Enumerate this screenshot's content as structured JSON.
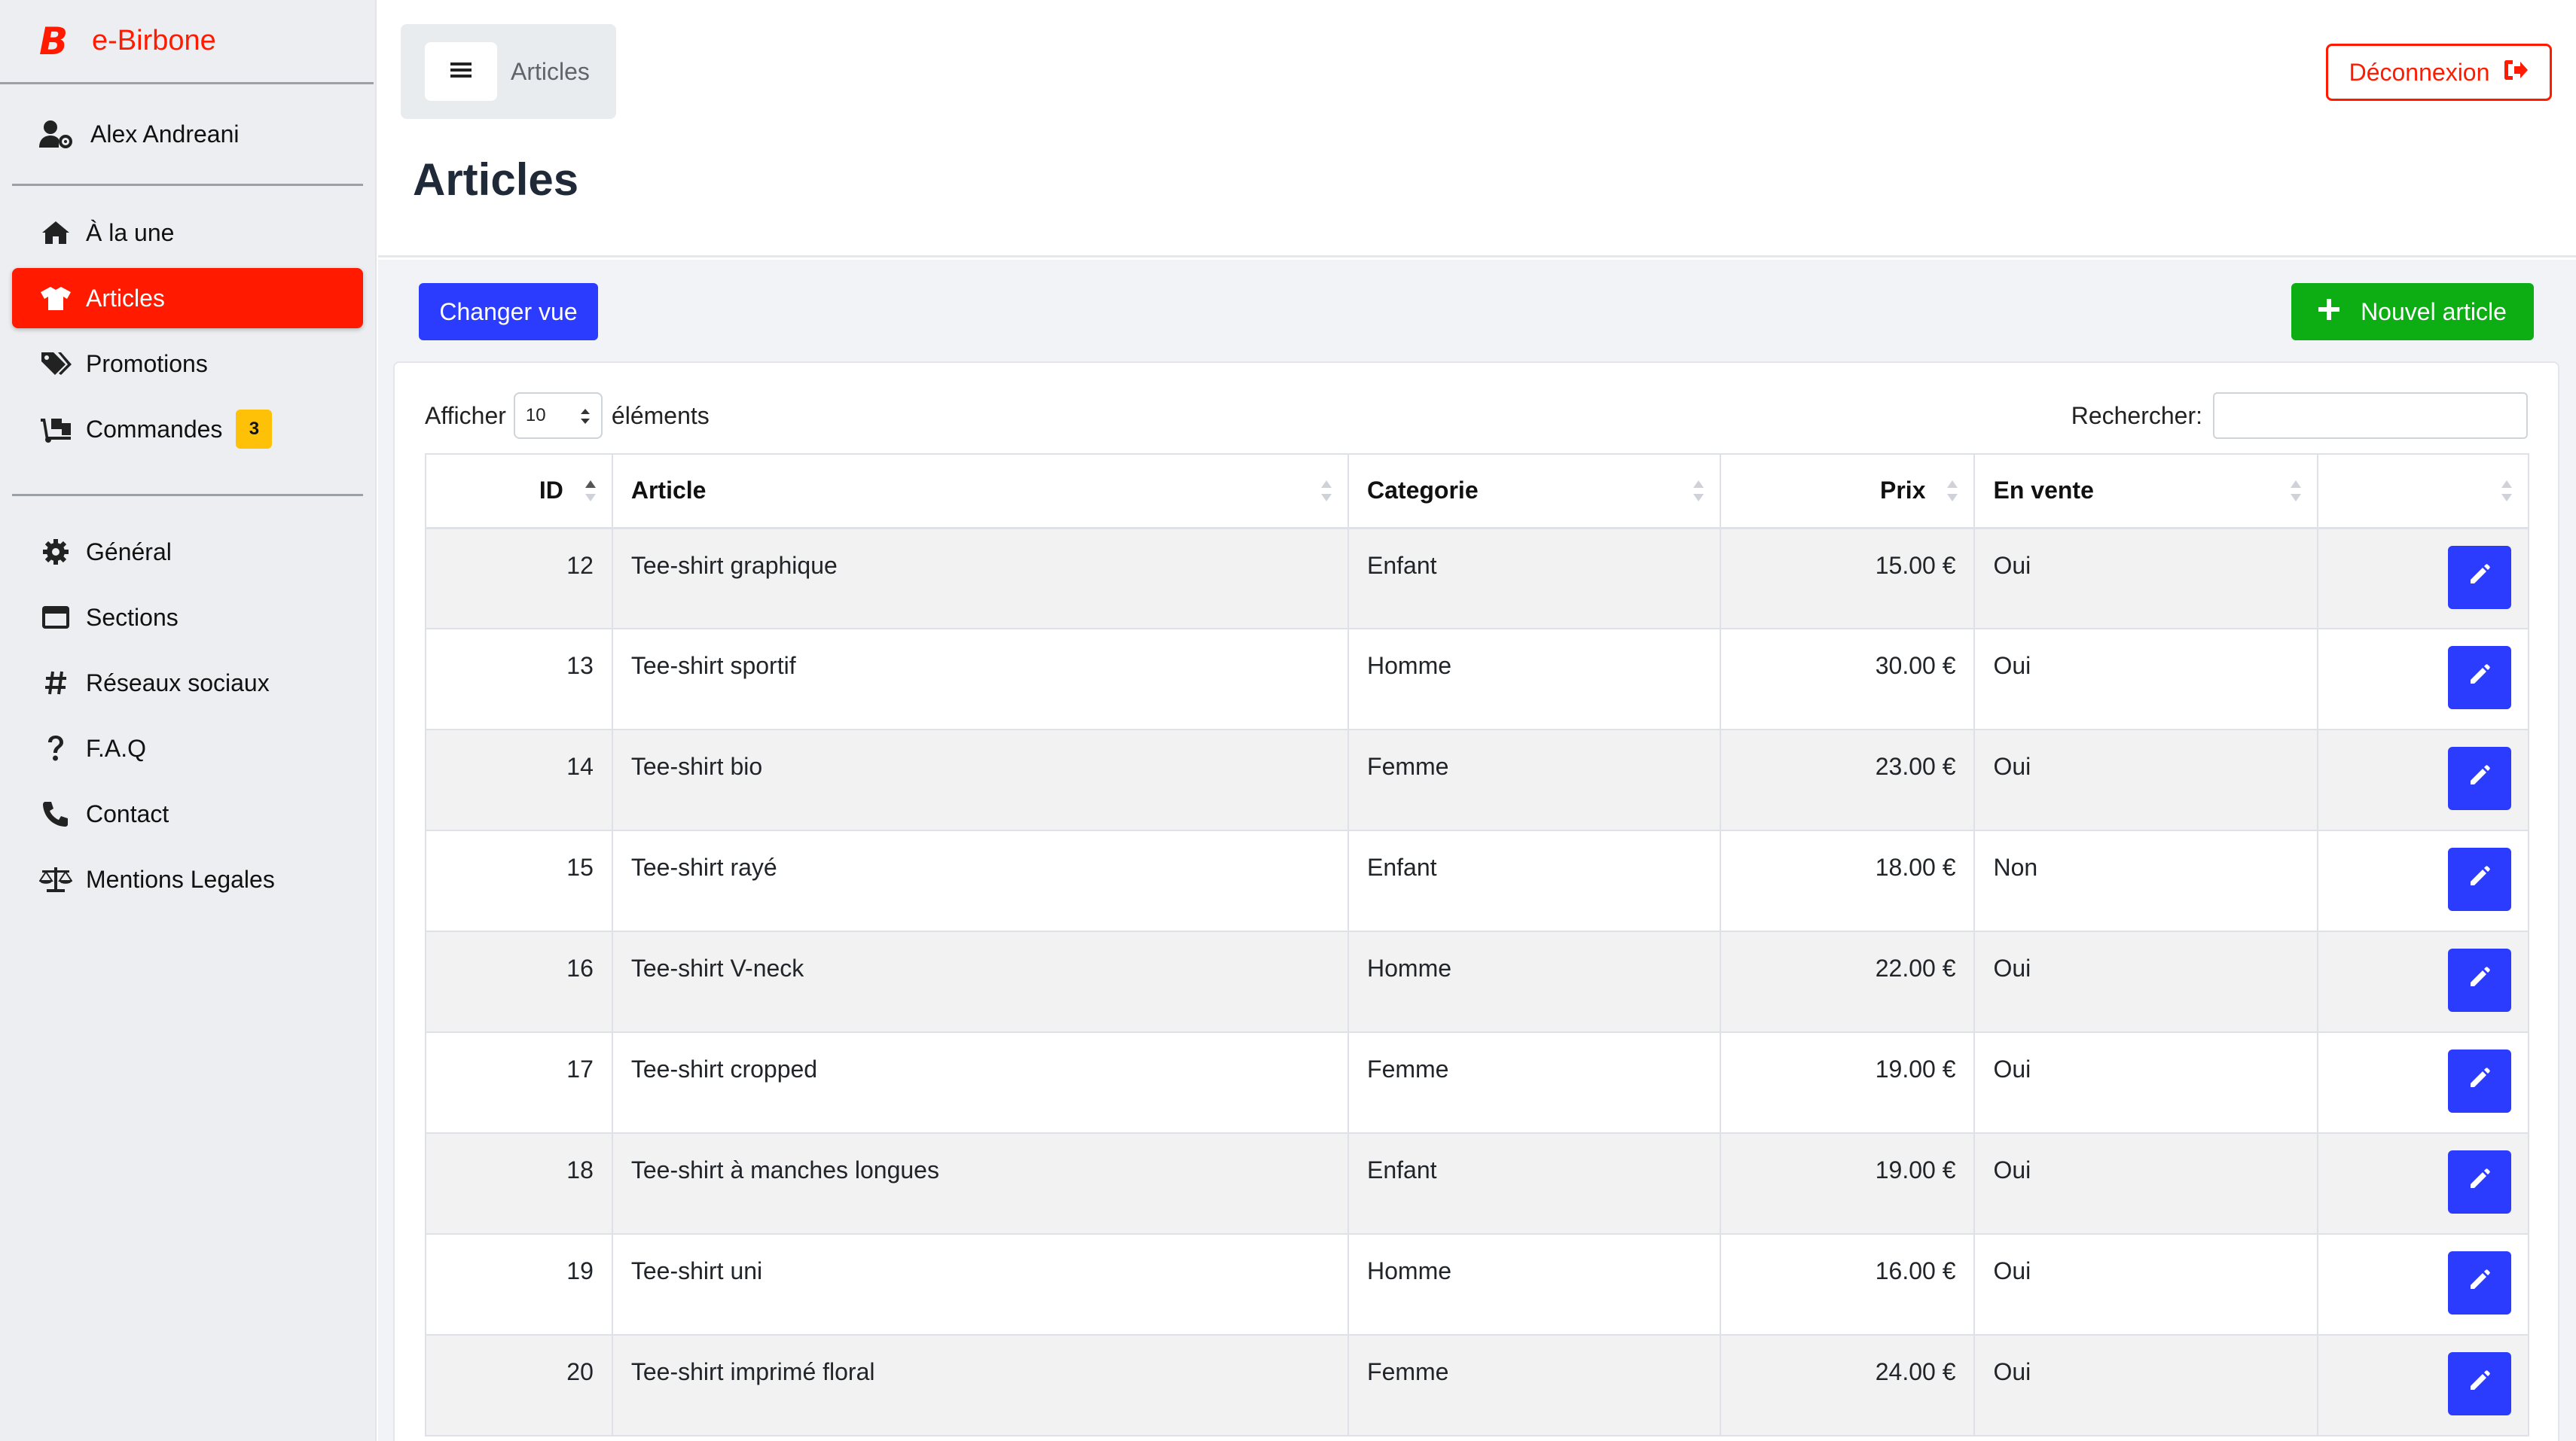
{
  "brand": {
    "logo": "B",
    "name": "e-Birbone"
  },
  "user": {
    "name": "Alex Andreani"
  },
  "nav": {
    "main": [
      {
        "label": "À la une",
        "icon": "home-icon"
      },
      {
        "label": "Articles",
        "icon": "tshirt-icon",
        "active": true
      },
      {
        "label": "Promotions",
        "icon": "tags-icon"
      },
      {
        "label": "Commandes",
        "icon": "dolly-icon",
        "badge": "3"
      }
    ],
    "settings": [
      {
        "label": "Général",
        "icon": "cog-icon"
      },
      {
        "label": "Sections",
        "icon": "window-icon"
      },
      {
        "label": "Réseaux sociaux",
        "icon": "hashtag-icon"
      },
      {
        "label": "F.A.Q",
        "icon": "question-icon"
      },
      {
        "label": "Contact",
        "icon": "phone-icon"
      },
      {
        "label": "Mentions Legales",
        "icon": "balance-scale-icon"
      }
    ]
  },
  "breadcrumb": {
    "current": "Articles"
  },
  "header": {
    "logout_label": "Déconnexion",
    "title": "Articles"
  },
  "toolbar": {
    "change_view_label": "Changer vue",
    "new_article_label": "Nouvel article"
  },
  "table_tools": {
    "show_prefix": "Afficher",
    "page_length": "10",
    "show_suffix": "éléments",
    "search_label": "Rechercher:",
    "search_value": ""
  },
  "table": {
    "columns": [
      "ID",
      "Article",
      "Categorie",
      "Prix",
      "En vente",
      ""
    ],
    "rows": [
      {
        "id": "12",
        "article": "Tee-shirt graphique",
        "categorie": "Enfant",
        "prix": "15.00 €",
        "en_vente": "Oui"
      },
      {
        "id": "13",
        "article": "Tee-shirt sportif",
        "categorie": "Homme",
        "prix": "30.00 €",
        "en_vente": "Oui"
      },
      {
        "id": "14",
        "article": "Tee-shirt bio",
        "categorie": "Femme",
        "prix": "23.00 €",
        "en_vente": "Oui"
      },
      {
        "id": "15",
        "article": "Tee-shirt rayé",
        "categorie": "Enfant",
        "prix": "18.00 €",
        "en_vente": "Non"
      },
      {
        "id": "16",
        "article": "Tee-shirt V-neck",
        "categorie": "Homme",
        "prix": "22.00 €",
        "en_vente": "Oui"
      },
      {
        "id": "17",
        "article": "Tee-shirt cropped",
        "categorie": "Femme",
        "prix": "19.00 €",
        "en_vente": "Oui"
      },
      {
        "id": "18",
        "article": "Tee-shirt à manches longues",
        "categorie": "Enfant",
        "prix": "19.00 €",
        "en_vente": "Oui"
      },
      {
        "id": "19",
        "article": "Tee-shirt uni",
        "categorie": "Homme",
        "prix": "16.00 €",
        "en_vente": "Oui"
      },
      {
        "id": "20",
        "article": "Tee-shirt imprimé floral",
        "categorie": "Femme",
        "prix": "24.00 €",
        "en_vente": "Oui"
      }
    ]
  },
  "colors": {
    "brand_red": "#ff1a00",
    "primary_blue": "#2b3cff",
    "success_green": "#0cae14",
    "badge_yellow": "#ffc107",
    "sidebar_bg": "#eceef1"
  }
}
